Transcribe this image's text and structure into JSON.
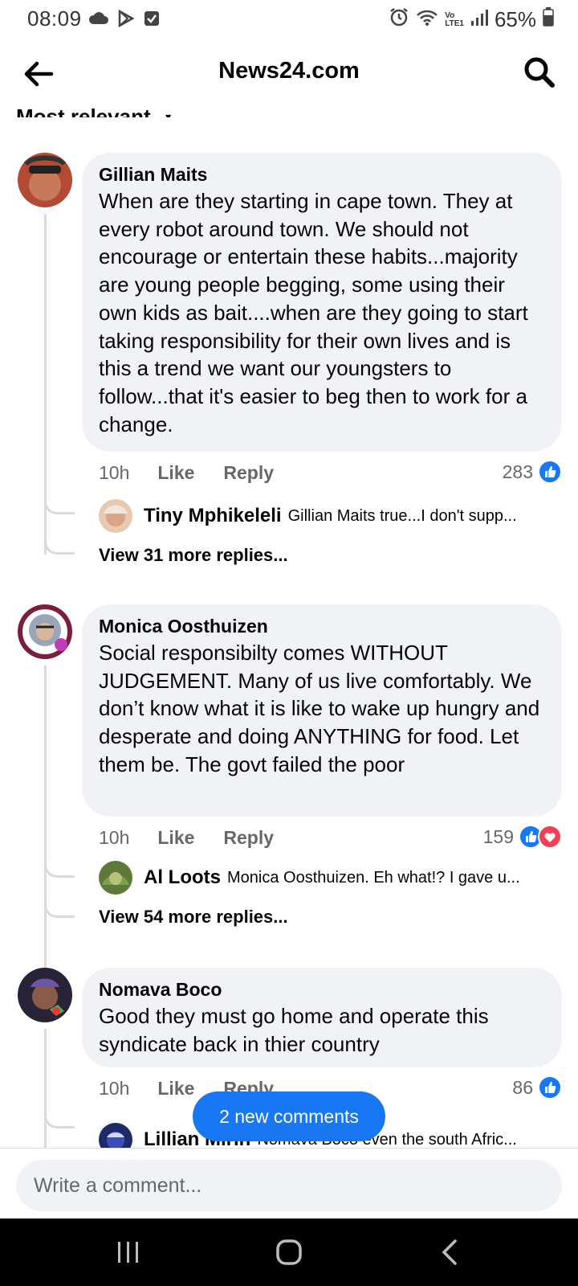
{
  "status_bar": {
    "time": "08:09",
    "battery": "65%",
    "network": "LTE1",
    "carrier_tag": "Vo",
    "icons": [
      "cloud-icon",
      "play-store-icon",
      "checkbox-icon",
      "alarm-icon",
      "wifi-icon",
      "signal-icon",
      "battery-icon"
    ]
  },
  "header": {
    "title": "News24.com",
    "back_icon": "back-arrow-icon",
    "search_icon": "search-icon"
  },
  "sort": {
    "label": "Most relevant"
  },
  "comments": [
    {
      "author": "Gillian Maits",
      "text": "When are they starting in cape town. They at every robot around town. We should not encourage or entertain these habits...majority are young people begging, some using their own kids as bait....when are they going to start taking responsibility for their own lives and is this a trend we want our youngsters to follow...that it's easier to beg then to work for a change.",
      "time": "10h",
      "like_label": "Like",
      "reply_label": "Reply",
      "reactions": "283",
      "reply_preview": {
        "author": "Tiny Mphikeleli",
        "text": "Gillian Maits true...I don't supp..."
      },
      "view_more": "View 31 more replies..."
    },
    {
      "author": "Monica Oosthuizen",
      "text": "Social responsibilty comes WITHOUT JUDGEMENT. Many of us live comfortably. We don’t know what it is like to wake up hungry and desperate and doing ANYTHING for food. Let them be. The govt failed the poor",
      "time": "10h",
      "like_label": "Like",
      "reply_label": "Reply",
      "reactions": "159",
      "reply_preview": {
        "author": "Al Loots",
        "text": "Monica Oosthuizen. Eh what!? I gave u..."
      },
      "view_more": "View 54 more replies..."
    },
    {
      "author": "Nomava Boco",
      "text": "Good they must go home and operate this syndicate back in thier country",
      "time": "10h",
      "like_label": "Like",
      "reply_label": "Reply",
      "reactions": "86",
      "reply_preview": {
        "author": "Lillian Mirih",
        "text": "Nomava Boco even the south Afric..."
      }
    }
  ],
  "new_comments_pill": "2 new comments",
  "composer": {
    "placeholder": "Write a comment..."
  },
  "colors": {
    "accent": "#1877f2",
    "love": "#f33e58",
    "bubble": "#f0f2f5",
    "secondary_text": "#65676b"
  }
}
